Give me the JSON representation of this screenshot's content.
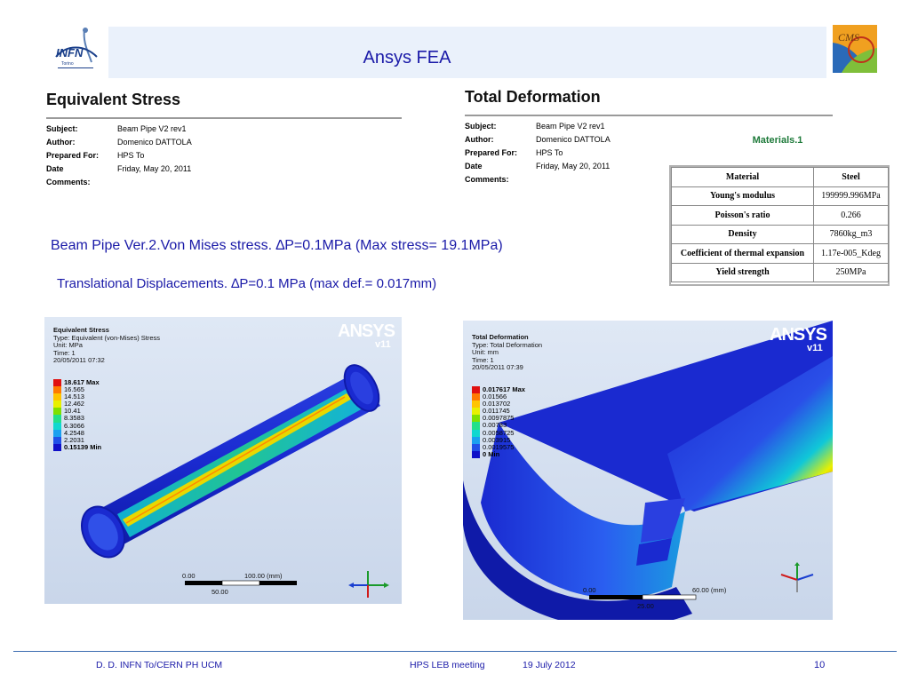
{
  "slide": {
    "title": "Ansys FEA",
    "footer": {
      "left": "D. D. INFN To/CERN PH UCM",
      "meeting": "HPS LEB meeting",
      "date": "19 July 2012",
      "page": "10"
    }
  },
  "logos": {
    "left": "INFN",
    "right": "CMS"
  },
  "stress_report": {
    "heading": "Equivalent Stress",
    "fields": [
      {
        "key": "Subject:",
        "value": "Beam Pipe V2 rev1"
      },
      {
        "key": "Author:",
        "value": "Domenico DATTOLA"
      },
      {
        "key": "Prepared For:",
        "value": "HPS To"
      },
      {
        "key": "Date",
        "value": "Friday, May 20, 2011"
      },
      {
        "key": "Comments:",
        "value": ""
      }
    ]
  },
  "deform_report": {
    "heading": "Total Deformation",
    "fields": [
      {
        "key": "Subject:",
        "value": "Beam Pipe V2 rev1"
      },
      {
        "key": "Author:",
        "value": "Domenico DATTOLA"
      },
      {
        "key": "Prepared For:",
        "value": "HPS To"
      },
      {
        "key": "Date",
        "value": "Friday, May 20, 2011"
      },
      {
        "key": "Comments:",
        "value": ""
      }
    ]
  },
  "materials": {
    "title": "Materials.1",
    "header": [
      "Material",
      "Steel"
    ],
    "rows": [
      [
        "Young's modulus",
        "199999.996MPa"
      ],
      [
        "Poisson's ratio",
        "0.266"
      ],
      [
        "Density",
        "7860kg_m3"
      ],
      [
        "Coefficient of thermal expansion",
        "1.17e-005_Kdeg"
      ],
      [
        "Yield strength",
        "250MPa"
      ]
    ]
  },
  "captions": {
    "stress": "Beam Pipe Ver.2.Von Mises stress. ∆P=0.1MPa (Max stress= 19.1MPa)",
    "deformation": "Translational Displacements. ∆P=0.1 MPa (max def.= 0.017mm)"
  },
  "fea_stress": {
    "info": [
      "Equivalent Stress",
      "Type: Equivalent (von-Mises) Stress",
      "Unit: MPa",
      "Time: 1",
      "20/05/2011 07:32"
    ],
    "legend": [
      {
        "label": "18.617 Max",
        "color": "#e01010",
        "bold": true
      },
      {
        "label": "16.565",
        "color": "#ff7a00"
      },
      {
        "label": "14.513",
        "color": "#ffc400"
      },
      {
        "label": "12.462",
        "color": "#e8f000"
      },
      {
        "label": "10.41",
        "color": "#7fe000"
      },
      {
        "label": "8.3583",
        "color": "#22e08a"
      },
      {
        "label": "6.3066",
        "color": "#10d8d0"
      },
      {
        "label": "4.2548",
        "color": "#1aa0f0"
      },
      {
        "label": "2.2031",
        "color": "#2050e8"
      },
      {
        "label": "0.15139 Min",
        "color": "#1010c8",
        "bold": true
      }
    ],
    "brand": "ANSYS",
    "version": "v11",
    "scale": {
      "start": "0.00",
      "end": "100.00 (mm)",
      "mid": "50.00"
    },
    "triad": [
      "X",
      "Y",
      "W"
    ]
  },
  "fea_deform": {
    "info": [
      "Total Deformation",
      "Type: Total Deformation",
      "Unit: mm",
      "Time: 1",
      "20/05/2011 07:39"
    ],
    "legend": [
      {
        "label": "0.017617 Max",
        "color": "#e01010",
        "bold": true
      },
      {
        "label": "0.01566",
        "color": "#ff7a00"
      },
      {
        "label": "0.013702",
        "color": "#ffc400"
      },
      {
        "label": "0.011745",
        "color": "#e8f000"
      },
      {
        "label": "0.0097875",
        "color": "#7fe000"
      },
      {
        "label": "0.00783",
        "color": "#22e08a"
      },
      {
        "label": "0.0058725",
        "color": "#10d8d0"
      },
      {
        "label": "0.003915",
        "color": "#1aa0f0"
      },
      {
        "label": "0.0019575",
        "color": "#2050e8"
      },
      {
        "label": "0 Min",
        "color": "#1010c8",
        "bold": true
      }
    ],
    "brand": "ANSYS",
    "version": "v11",
    "scale": {
      "start": "0.00",
      "end": "60.00 (mm)",
      "mid": "25.00"
    },
    "triad": [
      "X",
      "Y",
      "W"
    ]
  }
}
